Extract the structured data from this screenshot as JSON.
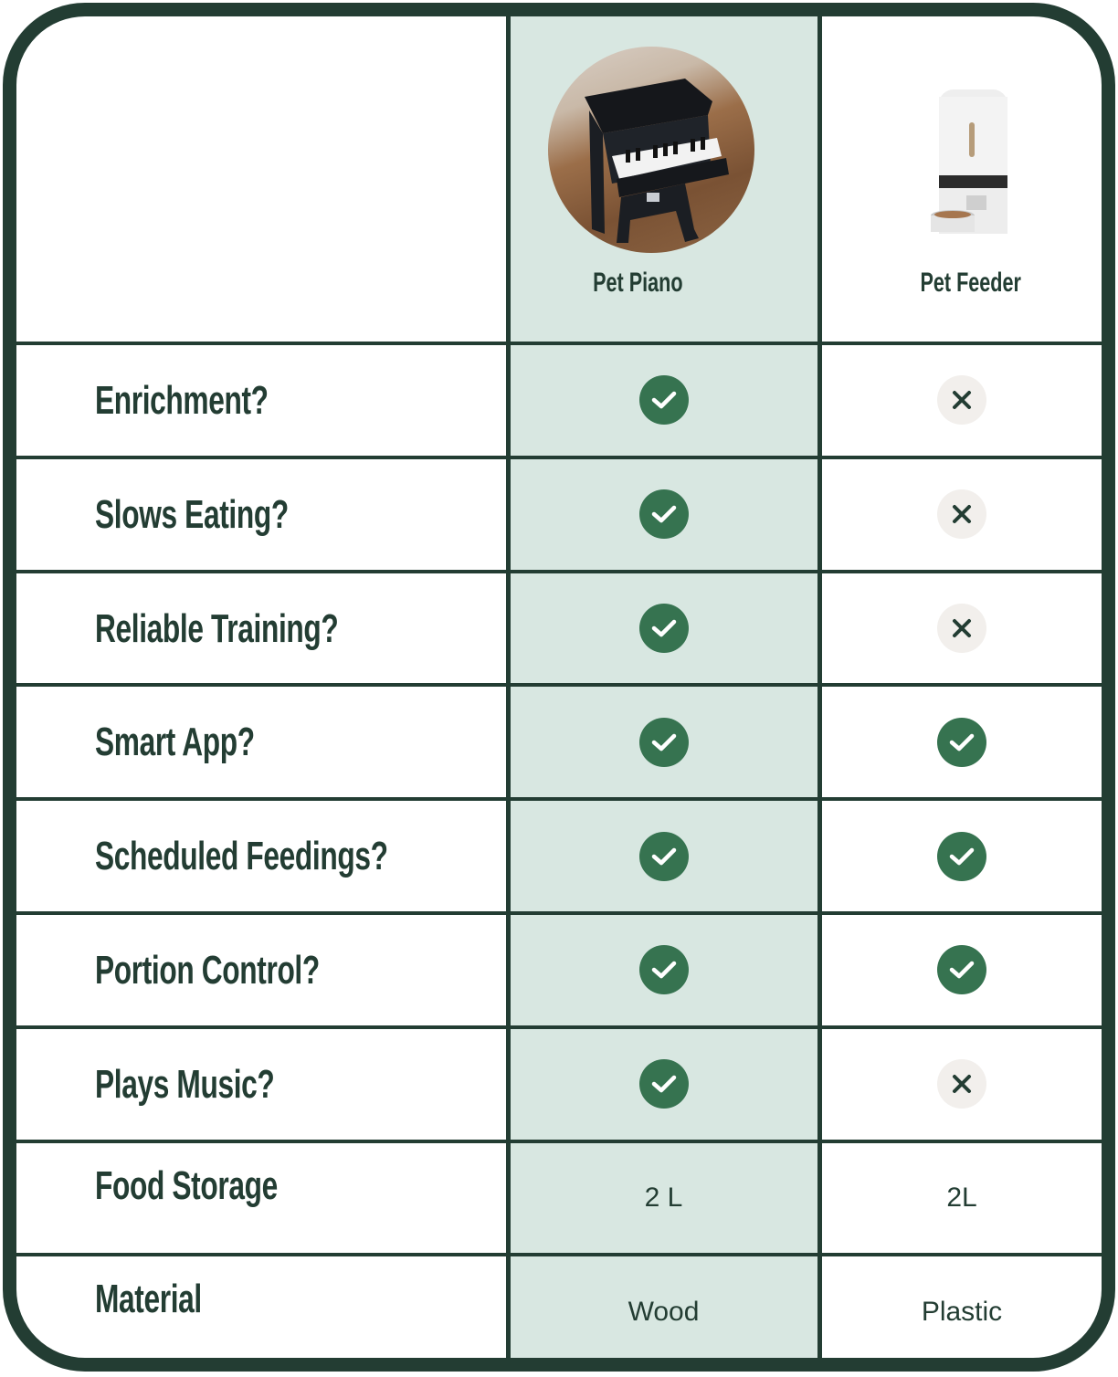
{
  "colors": {
    "border": "#233d33",
    "highlight_column": "#d8e7e1",
    "check_bg": "#367350",
    "cross_bg": "#f2efec",
    "text": "#233d33"
  },
  "products": [
    {
      "name": "Pet Piano",
      "image": "piano-photo",
      "highlighted": true
    },
    {
      "name": "Pet Feeder",
      "image": "feeder-photo",
      "highlighted": false
    }
  ],
  "rows": [
    {
      "label": "Enrichment?",
      "values": [
        "check",
        "cross"
      ]
    },
    {
      "label": "Slows Eating?",
      "values": [
        "check",
        "cross"
      ]
    },
    {
      "label": "Reliable Training?",
      "values": [
        "check",
        "cross"
      ]
    },
    {
      "label": "Smart App?",
      "values": [
        "check",
        "check"
      ]
    },
    {
      "label": "Scheduled Feedings?",
      "values": [
        "check",
        "check"
      ]
    },
    {
      "label": "Portion Control?",
      "values": [
        "check",
        "check"
      ]
    },
    {
      "label": "Plays Music?",
      "values": [
        "check",
        "cross"
      ]
    },
    {
      "label": "Food Storage",
      "values": [
        "2 L",
        "2L"
      ]
    },
    {
      "label": "Material",
      "values": [
        "Wood",
        "Plastic"
      ]
    }
  ]
}
